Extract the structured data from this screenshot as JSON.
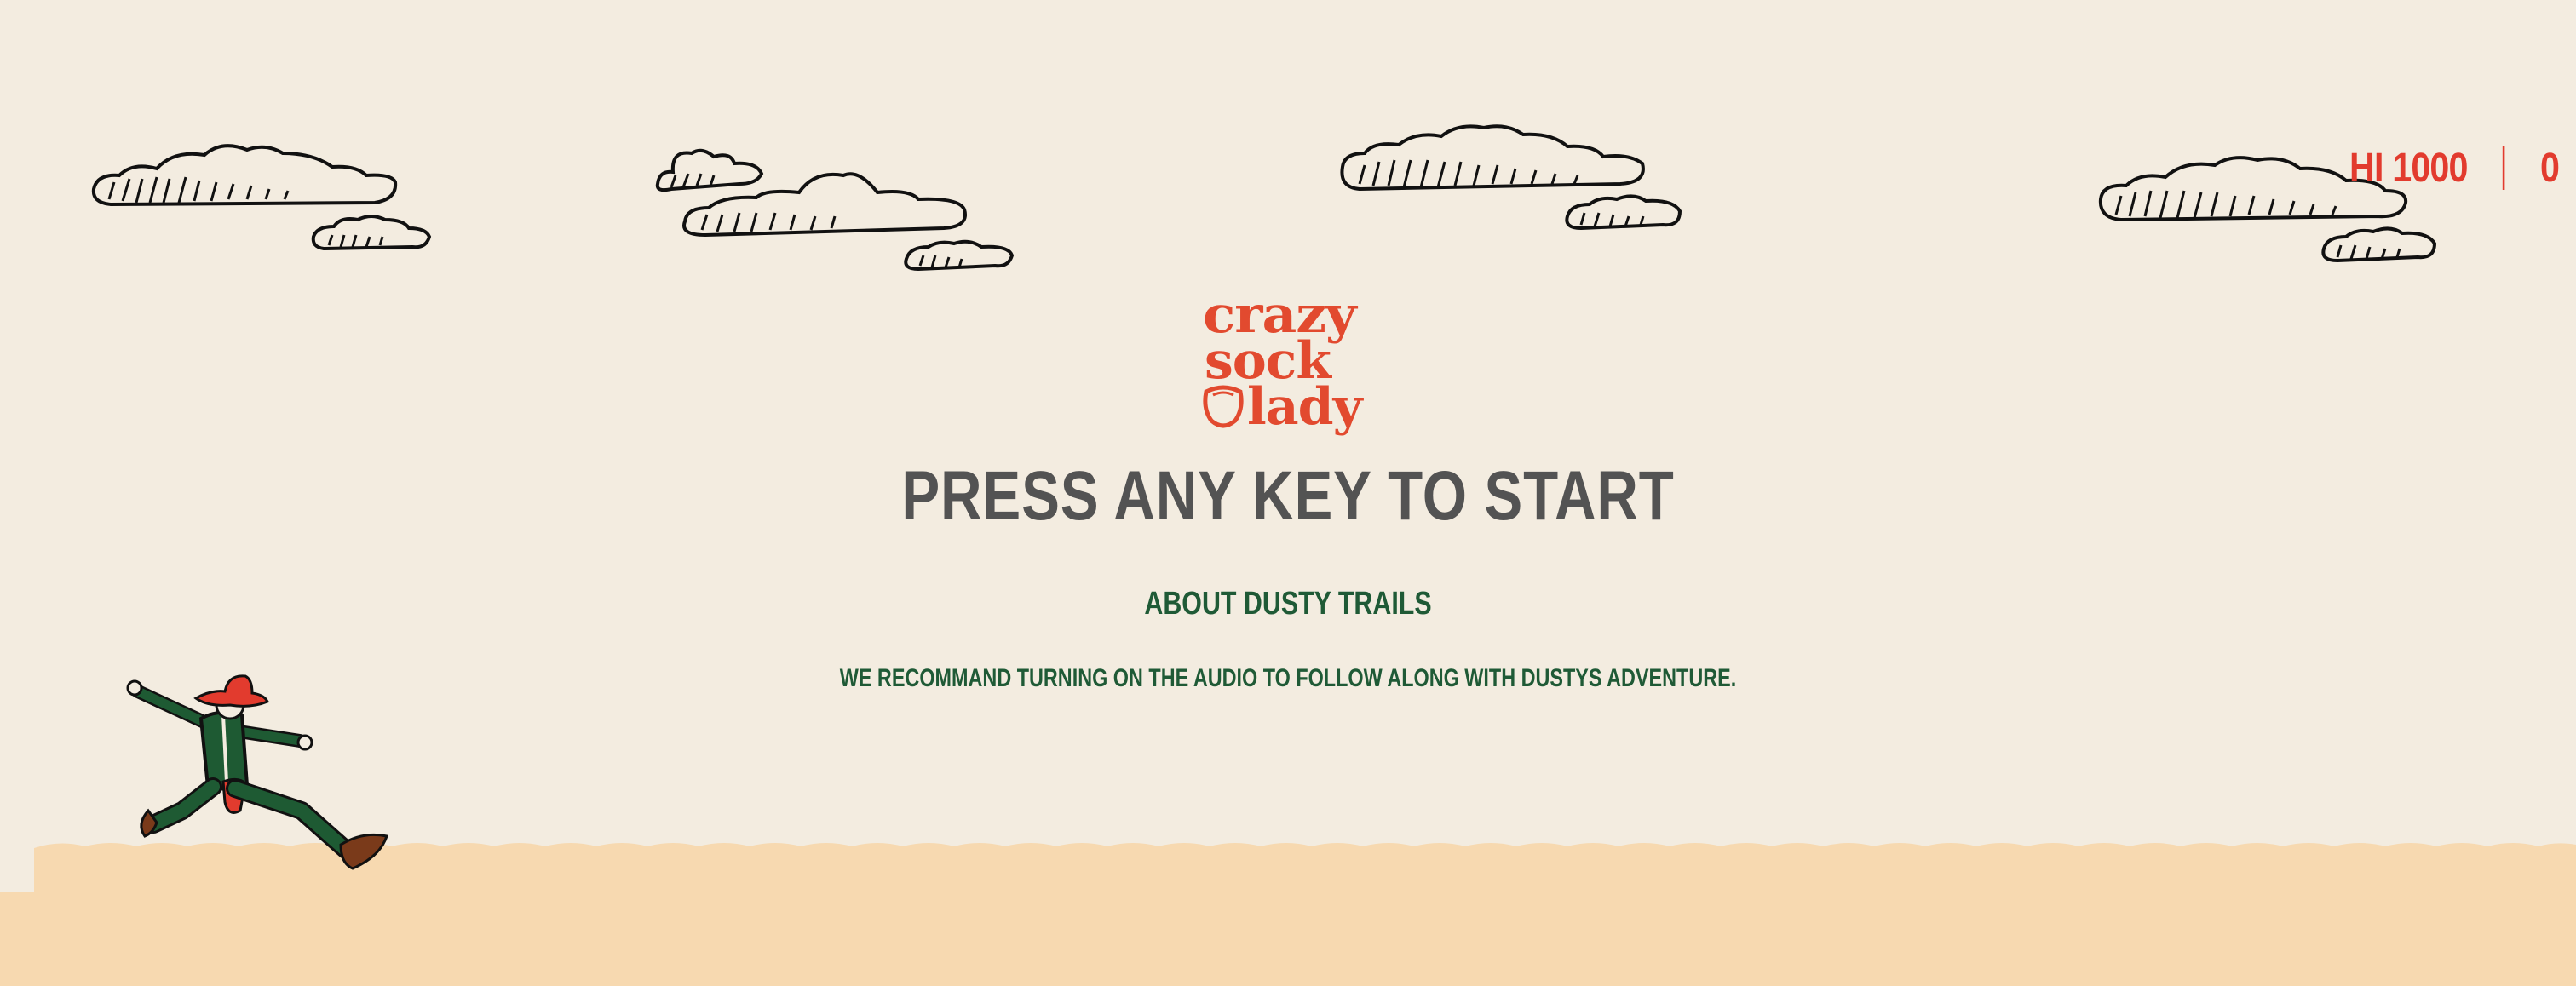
{
  "game": {
    "hi_label": "HI 1000",
    "current_score": "0"
  },
  "logo": {
    "line1": "crazy",
    "line2": "sock",
    "line3": "lady"
  },
  "prompt": {
    "start": "PRESS ANY KEY TO START",
    "about_link": "ABOUT DUSTY TRAILS",
    "audio_note": "WE RECOMMAND TURNING ON THE AUDIO TO FOLLOW ALONG WITH DUSTYS ADVENTURE."
  },
  "colors": {
    "background": "#f3ece0",
    "accent_red": "#e23b2e",
    "headline_gray": "#535353",
    "text_green": "#1f5a36",
    "sand": "#f7d9b0"
  },
  "icons": [
    "cloud-icon",
    "sock-icon",
    "cowboy-runner-icon"
  ]
}
